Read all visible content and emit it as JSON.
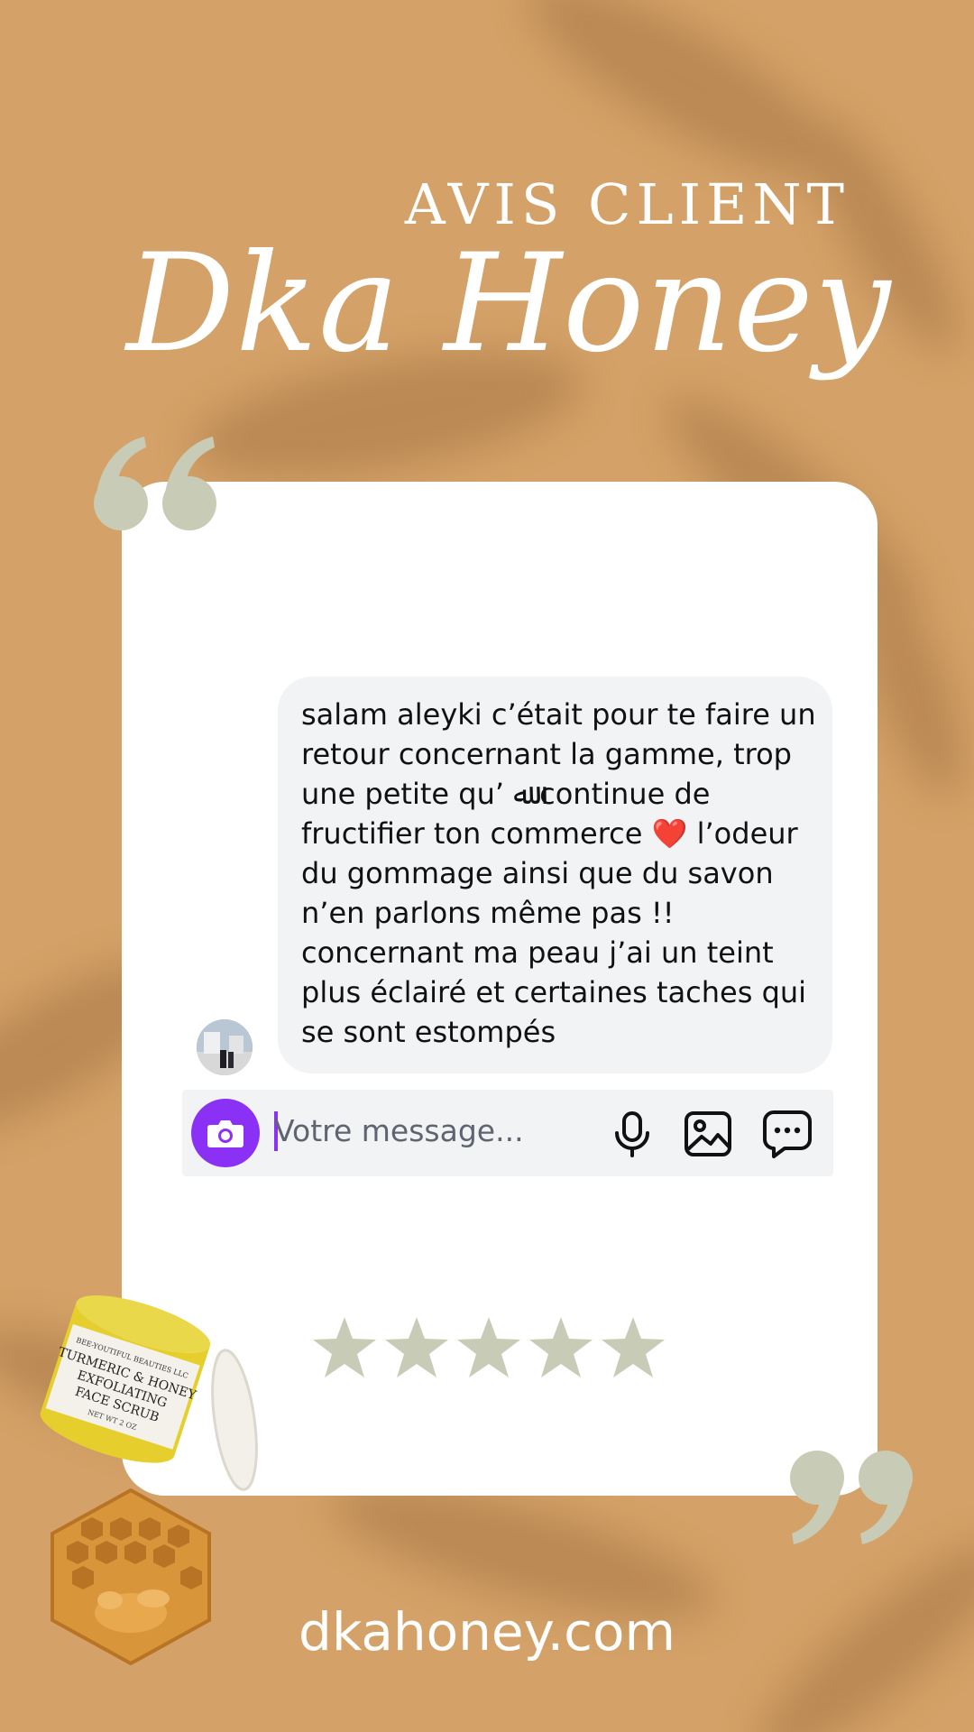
{
  "header": {
    "subtitle": "AVIS CLIENT",
    "brand": "Dka Honey"
  },
  "review": {
    "message": "salam aleyki c’était pour te faire un retour concernant la gamme, trop une petite qu’ ﷲ continue de fructifier ton commerce ❤️ l’odeur du gommage ainsi que du savon n’en parlons même pas !! concernant ma peau j’ai un teint plus éclairé et certaines taches qui se sont estompés"
  },
  "composer": {
    "placeholder": "Votre message...",
    "icons": [
      "camera-icon",
      "microphone-icon",
      "image-icon",
      "chat-icon"
    ]
  },
  "rating": {
    "value": 5,
    "max": 5
  },
  "product": {
    "jar_label_lines": [
      "BEE-YOUTIFUL BEAUTIES LLC",
      "TURMERIC & HONEY",
      "EXFOLIATING",
      "FACE SCRUB",
      "NET WT 2 OZ"
    ]
  },
  "footer": {
    "website": "dkahoney.com"
  },
  "colors": {
    "background": "#d4a268",
    "accent_sage": "#c8cbb5",
    "camera_button": "#8b31f5",
    "bubble": "#f2f3f5"
  }
}
